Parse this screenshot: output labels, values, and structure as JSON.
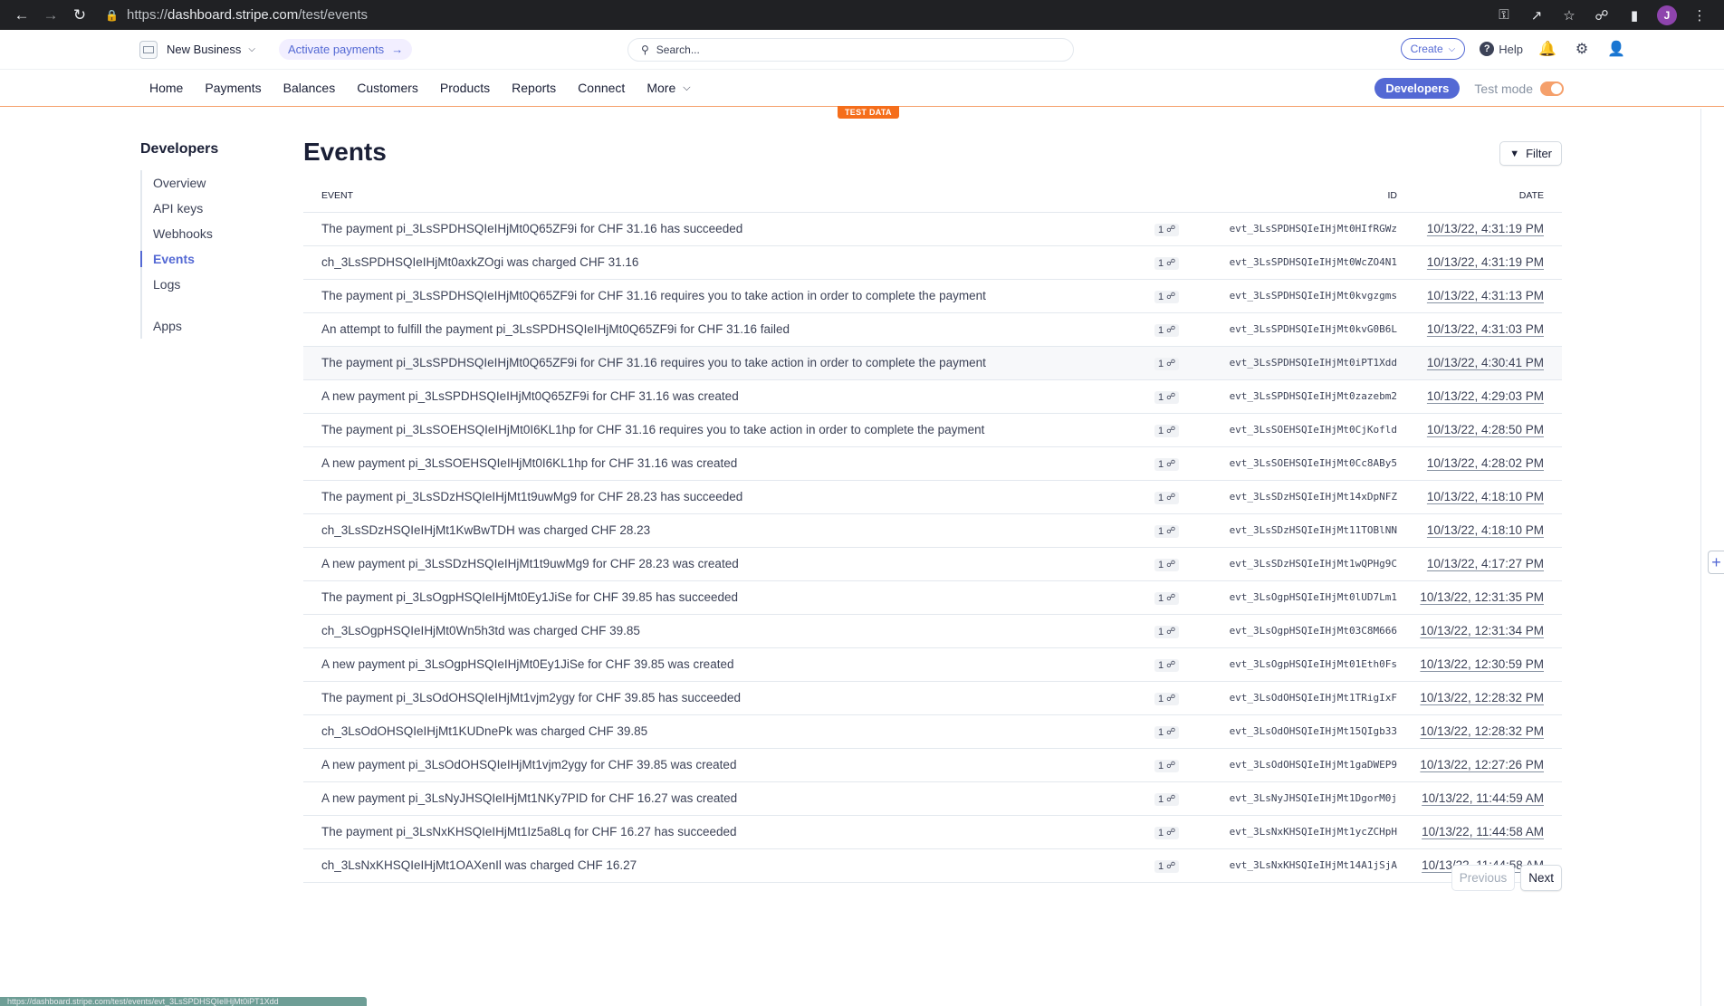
{
  "browser": {
    "url_scheme": "https://",
    "url_host": "dashboard.stripe.com",
    "url_path": "/test/events",
    "profile_initial": "J",
    "status_url": "https://dashboard.stripe.com/test/events/evt_3LsSPDHSQIeIHjMt0iPT1Xdd"
  },
  "topbar": {
    "business_name": "New Business",
    "activate_label": "Activate payments",
    "search_placeholder": "Search...",
    "create_label": "Create",
    "help_label": "Help"
  },
  "nav": {
    "items": [
      "Home",
      "Payments",
      "Balances",
      "Customers",
      "Products",
      "Reports",
      "Connect",
      "More"
    ],
    "developers_label": "Developers",
    "test_mode_label": "Test mode",
    "test_data_label": "TEST DATA"
  },
  "sidebar": {
    "title": "Developers",
    "items": [
      "Overview",
      "API keys",
      "Webhooks",
      "Events",
      "Logs"
    ],
    "extra_item": "Apps"
  },
  "main": {
    "title": "Events",
    "filter_label": "Filter",
    "columns": {
      "event": "EVENT",
      "id": "ID",
      "date": "DATE"
    },
    "rows": [
      {
        "event": "The payment pi_3LsSPDHSQIeIHjMt0Q65ZF9i for CHF 31.16 has succeeded",
        "count": "1",
        "id": "evt_3LsSPDHSQIeIHjMt0HIfRGWz",
        "date": "10/13/22, 4:31:19 PM"
      },
      {
        "event": "ch_3LsSPDHSQIeIHjMt0axkZOgi was charged CHF 31.16",
        "count": "1",
        "id": "evt_3LsSPDHSQIeIHjMt0WcZO4N1",
        "date": "10/13/22, 4:31:19 PM"
      },
      {
        "event": "The payment pi_3LsSPDHSQIeIHjMt0Q65ZF9i for CHF 31.16 requires you to take action in order to complete the payment",
        "count": "1",
        "id": "evt_3LsSPDHSQIeIHjMt0kvgzgms",
        "date": "10/13/22, 4:31:13 PM"
      },
      {
        "event": "An attempt to fulfill the payment pi_3LsSPDHSQIeIHjMt0Q65ZF9i for CHF 31.16 failed",
        "count": "1",
        "id": "evt_3LsSPDHSQIeIHjMt0kvG0B6L",
        "date": "10/13/22, 4:31:03 PM"
      },
      {
        "event": "The payment pi_3LsSPDHSQIeIHjMt0Q65ZF9i for CHF 31.16 requires you to take action in order to complete the payment",
        "count": "1",
        "id": "evt_3LsSPDHSQIeIHjMt0iPT1Xdd",
        "date": "10/13/22, 4:30:41 PM"
      },
      {
        "event": "A new payment pi_3LsSPDHSQIeIHjMt0Q65ZF9i for CHF 31.16 was created",
        "count": "1",
        "id": "evt_3LsSPDHSQIeIHjMt0zazebm2",
        "date": "10/13/22, 4:29:03 PM"
      },
      {
        "event": "The payment pi_3LsSOEHSQIeIHjMt0I6KL1hp for CHF 31.16 requires you to take action in order to complete the payment",
        "count": "1",
        "id": "evt_3LsSOEHSQIeIHjMt0CjKofld",
        "date": "10/13/22, 4:28:50 PM"
      },
      {
        "event": "A new payment pi_3LsSOEHSQIeIHjMt0I6KL1hp for CHF 31.16 was created",
        "count": "1",
        "id": "evt_3LsSOEHSQIeIHjMt0Cc8ABy5",
        "date": "10/13/22, 4:28:02 PM"
      },
      {
        "event": "The payment pi_3LsSDzHSQIeIHjMt1t9uwMg9 for CHF 28.23 has succeeded",
        "count": "1",
        "id": "evt_3LsSDzHSQIeIHjMt14xDpNFZ",
        "date": "10/13/22, 4:18:10 PM"
      },
      {
        "event": "ch_3LsSDzHSQIeIHjMt1KwBwTDH was charged CHF 28.23",
        "count": "1",
        "id": "evt_3LsSDzHSQIeIHjMt11TOBlNN",
        "date": "10/13/22, 4:18:10 PM"
      },
      {
        "event": "A new payment pi_3LsSDzHSQIeIHjMt1t9uwMg9 for CHF 28.23 was created",
        "count": "1",
        "id": "evt_3LsSDzHSQIeIHjMt1wQPHg9C",
        "date": "10/13/22, 4:17:27 PM"
      },
      {
        "event": "The payment pi_3LsOgpHSQIeIHjMt0Ey1JiSe for CHF 39.85 has succeeded",
        "count": "1",
        "id": "evt_3LsOgpHSQIeIHjMt0lUD7Lm1",
        "date": "10/13/22, 12:31:35 PM"
      },
      {
        "event": "ch_3LsOgpHSQIeIHjMt0Wn5h3td was charged CHF 39.85",
        "count": "1",
        "id": "evt_3LsOgpHSQIeIHjMt03C8M666",
        "date": "10/13/22, 12:31:34 PM"
      },
      {
        "event": "A new payment pi_3LsOgpHSQIeIHjMt0Ey1JiSe for CHF 39.85 was created",
        "count": "1",
        "id": "evt_3LsOgpHSQIeIHjMt01Eth0Fs",
        "date": "10/13/22, 12:30:59 PM"
      },
      {
        "event": "The payment pi_3LsOdOHSQIeIHjMt1vjm2ygy for CHF 39.85 has succeeded",
        "count": "1",
        "id": "evt_3LsOdOHSQIeIHjMt1TRigIxF",
        "date": "10/13/22, 12:28:32 PM"
      },
      {
        "event": "ch_3LsOdOHSQIeIHjMt1KUDnePk was charged CHF 39.85",
        "count": "1",
        "id": "evt_3LsOdOHSQIeIHjMt15QIgb33",
        "date": "10/13/22, 12:28:32 PM"
      },
      {
        "event": "A new payment pi_3LsOdOHSQIeIHjMt1vjm2ygy for CHF 39.85 was created",
        "count": "1",
        "id": "evt_3LsOdOHSQIeIHjMt1gaDWEP9",
        "date": "10/13/22, 12:27:26 PM"
      },
      {
        "event": "A new payment pi_3LsNyJHSQIeIHjMt1NKy7PID for CHF 16.27 was created",
        "count": "1",
        "id": "evt_3LsNyJHSQIeIHjMt1DgorM0j",
        "date": "10/13/22, 11:44:59 AM"
      },
      {
        "event": "The payment pi_3LsNxKHSQIeIHjMt1Iz5a8Lq for CHF 16.27 has succeeded",
        "count": "1",
        "id": "evt_3LsNxKHSQIeIHjMt1ycZCHpH",
        "date": "10/13/22, 11:44:58 AM"
      },
      {
        "event": "ch_3LsNxKHSQIeIHjMt1OAXenIl was charged CHF 16.27",
        "count": "1",
        "id": "evt_3LsNxKHSQIeIHjMt14A1jSjA",
        "date": "10/13/22, 11:44:58 AM"
      }
    ],
    "hover_row_index": 4,
    "pagination": {
      "previous": "Previous",
      "next": "Next"
    }
  },
  "colors": {
    "accent": "#5469d4",
    "test_mode": "#f56e1b"
  }
}
